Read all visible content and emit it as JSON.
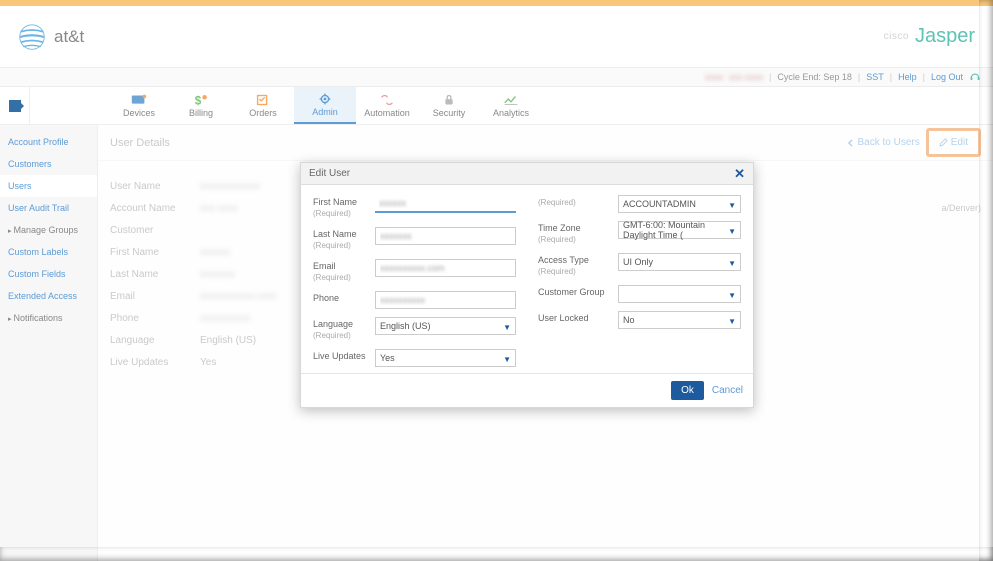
{
  "brand": {
    "name": "at&t",
    "partner_prefix": "cisco",
    "partner": "Jasper"
  },
  "topline": {
    "blurred_a": "xxxx",
    "blurred_b": "xxx xxxx",
    "cycle": "Cycle End: Sep 18",
    "sst": "SST",
    "help": "Help",
    "logout": "Log Out"
  },
  "nav": {
    "devices": "Devices",
    "billing": "Billing",
    "orders": "Orders",
    "admin": "Admin",
    "automation": "Automation",
    "security": "Security",
    "analytics": "Analytics"
  },
  "sidebar": {
    "items": [
      "Account Profile",
      "Customers",
      "Users",
      "User Audit Trail",
      "Manage Groups",
      "Custom Labels",
      "Custom Fields",
      "Extended Access",
      "Notifications"
    ]
  },
  "page": {
    "title": "User Details",
    "back": "Back to Users",
    "edit": "Edit"
  },
  "details": {
    "rows": [
      {
        "label": "User Name",
        "value": "xxxxxxxxxxxx"
      },
      {
        "label": "Account Name",
        "value": "xxx xxxx"
      },
      {
        "label": "Customer",
        "value": ""
      },
      {
        "label": "First Name",
        "value": "xxxxxx"
      },
      {
        "label": "Last Name",
        "value": "xxxxxxx"
      },
      {
        "label": "Email",
        "value": "xxxxxxxxxxx.com"
      },
      {
        "label": "Phone",
        "value": "xxxxxxxxxx"
      },
      {
        "label": "Language",
        "value": "English (US)",
        "noblur": true
      },
      {
        "label": "Live Updates",
        "value": "Yes",
        "noblur": true
      }
    ],
    "tz_extra": "a/Denver)"
  },
  "modal": {
    "title": "Edit User",
    "required": "(Required)",
    "first_name": {
      "label": "First Name",
      "value": "xxxxxx"
    },
    "last_name": {
      "label": "Last Name",
      "value": "xxxxxxx"
    },
    "email": {
      "label": "Email",
      "value": "xxxxxxxxxx.com"
    },
    "phone": {
      "label": "Phone",
      "value": "xxxxxxxxxx"
    },
    "language": {
      "label": "Language",
      "value": "English (US)"
    },
    "live_updates": {
      "label": "Live Updates",
      "value": "Yes"
    },
    "role": {
      "label": "",
      "value": "ACCOUNTADMIN",
      "required_right": "(Required)"
    },
    "time_zone": {
      "label": "Time Zone",
      "value": "GMT-6:00: Mountain Daylight Time ("
    },
    "access_type": {
      "label": "Access Type",
      "value": "UI Only"
    },
    "customer_group": {
      "label": "Customer Group",
      "value": ""
    },
    "user_locked": {
      "label": "User Locked",
      "value": "No"
    },
    "ok": "Ok",
    "cancel": "Cancel"
  }
}
